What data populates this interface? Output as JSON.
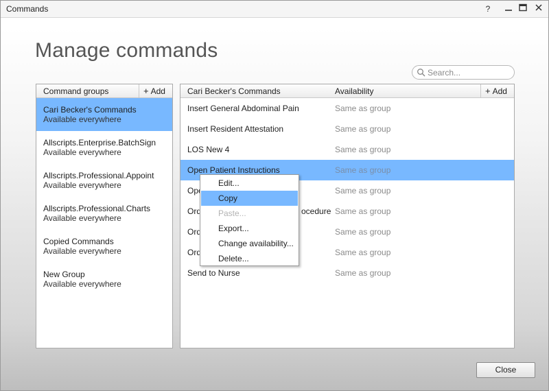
{
  "window": {
    "title": "Commands",
    "help_glyph": "?",
    "minimize_glyph": "—",
    "maximize_glyph": "☐",
    "close_glyph": "✕"
  },
  "page": {
    "heading": "Manage commands"
  },
  "search": {
    "placeholder": "Search...",
    "value": "",
    "icon": "search-icon"
  },
  "groups": {
    "header": "Command groups",
    "add_label": "Add",
    "add_plus": "+",
    "items": [
      {
        "name": "Cari Becker's Commands",
        "sub": "Available everywhere",
        "selected": true
      },
      {
        "name": "Allscripts.Enterprise.BatchSign",
        "sub": "Available everywhere"
      },
      {
        "name": "Allscripts.Professional.Appoint",
        "sub": "Available everywhere"
      },
      {
        "name": "Allscripts.Professional.Charts",
        "sub": "Available everywhere"
      },
      {
        "name": "Copied Commands",
        "sub": "Available everywhere"
      },
      {
        "name": "New Group",
        "sub": "Available everywhere"
      }
    ]
  },
  "commands": {
    "header_name": "Cari Becker's Commands",
    "header_availability": "Availability",
    "add_label": "Add",
    "add_plus": "+",
    "rows": [
      {
        "name": "Insert General Abdominal Pain",
        "availability": "Same as group"
      },
      {
        "name": "Insert Resident Attestation",
        "availability": "Same as group"
      },
      {
        "name": "LOS New 4",
        "availability": "Same as group"
      },
      {
        "name": "Open Patient Instructions",
        "availability": "Same as group",
        "selected": true
      },
      {
        "name": "Ope",
        "availability": "Same as group"
      },
      {
        "name": "Ord",
        "name_suffix": "ocedure",
        "availability": "Same as group"
      },
      {
        "name": "Ord",
        "availability": "Same as group"
      },
      {
        "name": "Ord",
        "availability": "Same as group"
      },
      {
        "name": "Send to Nurse",
        "availability": "Same as group"
      }
    ]
  },
  "context_menu": {
    "items": [
      {
        "label": "Edit...",
        "state": "normal"
      },
      {
        "label": "Copy",
        "state": "hover"
      },
      {
        "label": "Paste...",
        "state": "disabled"
      },
      {
        "label": "Export...",
        "state": "normal"
      },
      {
        "label": "Change availability...",
        "state": "normal"
      },
      {
        "label": "Delete...",
        "state": "normal"
      }
    ]
  },
  "footer": {
    "close_label": "Close"
  },
  "colors": {
    "selection": "#78b8ff",
    "muted_text": "#8a8a8a",
    "disabled_text": "#b3b3b3"
  }
}
